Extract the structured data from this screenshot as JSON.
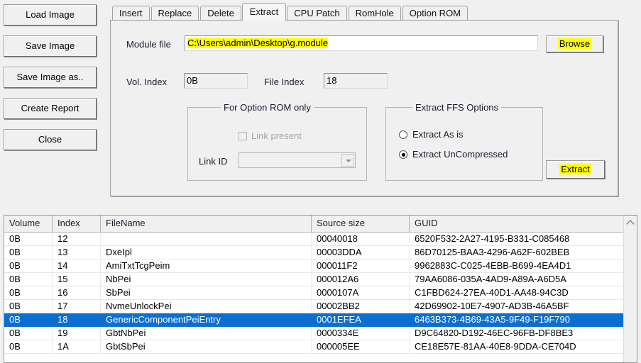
{
  "side_buttons": [
    {
      "label": "Load Image",
      "name": "load-image-button"
    },
    {
      "label": "Save Image",
      "name": "save-image-button"
    },
    {
      "label": "Save Image as..",
      "name": "save-image-as-button"
    },
    {
      "label": "Create Report",
      "name": "create-report-button"
    },
    {
      "label": "Close",
      "name": "close-button"
    }
  ],
  "tabs": [
    {
      "label": "Insert",
      "selected": false
    },
    {
      "label": "Replace",
      "selected": false
    },
    {
      "label": "Delete",
      "selected": false
    },
    {
      "label": "Extract",
      "selected": true
    },
    {
      "label": "CPU Patch",
      "selected": false
    },
    {
      "label": "RomHole",
      "selected": false
    },
    {
      "label": "Option ROM",
      "selected": false
    }
  ],
  "extract_tab": {
    "module_file": {
      "label": "Module file",
      "value": "C:\\Users\\admin\\Desktop\\g.module",
      "placeholder": "",
      "highlighted": true
    },
    "browse_button": {
      "label": "Browse",
      "highlighted": true
    },
    "vol_index": {
      "label": "Vol. Index",
      "value": "0B"
    },
    "file_index": {
      "label": "File Index",
      "value": "18"
    },
    "option_rom_group": {
      "title": "For Option ROM only",
      "link_present": {
        "label": "Link present",
        "checked": false,
        "disabled": true
      },
      "link_id": {
        "label": "Link ID",
        "value": "",
        "placeholder": ""
      }
    },
    "ffs_options_group": {
      "title": "Extract FFS Options",
      "options": [
        {
          "label": "Extract As is",
          "checked": false
        },
        {
          "label": "Extract UnCompressed",
          "checked": true
        }
      ]
    },
    "extract_button": {
      "label": "Extract",
      "highlighted": true
    }
  },
  "list_view": {
    "columns": [
      "Volume",
      "Index",
      "FileName",
      "Source size",
      "GUID"
    ],
    "scroll_up_icon": "chevron-up-icon",
    "rows": [
      {
        "volume": "0B",
        "index": "12",
        "filename": "",
        "size": "00040018",
        "guid": "6520F532-2A27-4195-B331-C085468",
        "selected": false
      },
      {
        "volume": "0B",
        "index": "13",
        "filename": "DxeIpl",
        "size": "00003DDA",
        "guid": "86D70125-BAA3-4296-A62F-602BEB",
        "selected": false
      },
      {
        "volume": "0B",
        "index": "14",
        "filename": "AmiTxtTcgPeim",
        "size": "000011F2",
        "guid": "9962883C-C025-4EBB-B699-4EA4D1",
        "selected": false
      },
      {
        "volume": "0B",
        "index": "15",
        "filename": "NbPei",
        "size": "000012A6",
        "guid": "79AA6086-035A-4AD9-A89A-A6D5A",
        "selected": false
      },
      {
        "volume": "0B",
        "index": "16",
        "filename": "SbPei",
        "size": "0000107A",
        "guid": "C1FBD624-27EA-40D1-AA48-94C3D",
        "selected": false
      },
      {
        "volume": "0B",
        "index": "17",
        "filename": "NvmeUnlockPei",
        "size": "00002BB2",
        "guid": "42D69902-10E7-4907-AD3B-46A5BF",
        "selected": false
      },
      {
        "volume": "0B",
        "index": "18",
        "filename": "GenericComponentPeiEntry",
        "size": "0001EFEA",
        "guid": "6463B373-4B69-43A5-9F49-F19F790",
        "selected": true
      },
      {
        "volume": "0B",
        "index": "19",
        "filename": "GbtNbPei",
        "size": "0000334E",
        "guid": "D9C64820-D192-46EC-96FB-DF8BE3",
        "selected": false
      },
      {
        "volume": "0B",
        "index": "1A",
        "filename": "GbtSbPei",
        "size": "000005EE",
        "guid": "CE18E57E-81AA-40E8-9DDA-CE704D",
        "selected": false
      }
    ]
  },
  "colors": {
    "selection": "#0b6fd1",
    "highlight": "#ffff00",
    "face": "#f0f0f0"
  }
}
